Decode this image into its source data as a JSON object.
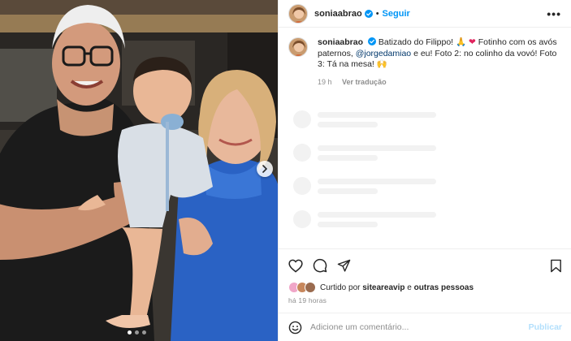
{
  "post": {
    "username": "soniaabrao",
    "follow_label": "Seguir",
    "separator": "•",
    "more_label": "•••",
    "verified": true,
    "accent_color": "#0095f6"
  },
  "caption": {
    "username": "soniaabrao",
    "text_1": "Batizado do Filippo! ",
    "emoji_1": "🙏",
    "emoji_2": "❤",
    "text_2": " Fotinho com os avós paternos, ",
    "mention": "@jorgedamiao",
    "text_3": " e eu! Foto 2: no colinho da vovó! Foto 3: Tá na mesa! ",
    "emoji_3": "🙌",
    "age": "19 h",
    "translate_label": "Ver tradução"
  },
  "actions": {
    "icons": [
      "heart-icon",
      "comment-icon",
      "share-icon",
      "bookmark-icon"
    ]
  },
  "likes": {
    "prefix": "Curtido por ",
    "user": "sitearеavip",
    "suffix": " e ",
    "others": "outras pessoas"
  },
  "timestamp": "há 19 horas",
  "comment": {
    "placeholder": "Adicione um comentário...",
    "publish_label": "Publicar",
    "emoji_icon": "smiley-icon"
  },
  "carousel": {
    "total": 3,
    "current": 1
  }
}
